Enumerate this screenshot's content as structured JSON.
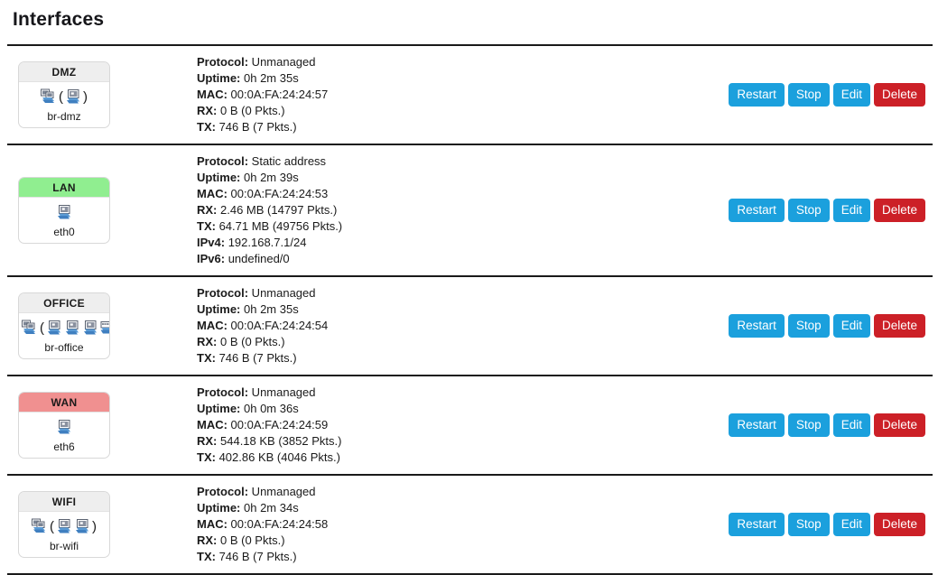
{
  "page": {
    "title": "Interfaces"
  },
  "actions": {
    "restart_label": "Restart",
    "stop_label": "Stop",
    "edit_label": "Edit",
    "delete_label": "Delete",
    "blue_color": "#1ba0dd",
    "red_color": "#cc2027"
  },
  "labels": {
    "protocol": "Protocol:",
    "uptime": "Uptime:",
    "mac": "MAC:",
    "rx": "RX:",
    "tx": "TX:",
    "ipv4": "IPv4:",
    "ipv6": "IPv6:"
  },
  "interfaces": [
    {
      "zone": "DMZ",
      "zone_color": "#eeeeee",
      "device": "br-dmz",
      "icons": [
        "bridge-icon",
        "paren-open",
        "ethernet-icon",
        "paren-close"
      ],
      "protocol": "Unmanaged",
      "uptime": "0h 2m 35s",
      "mac": "00:0A:FA:24:24:57",
      "rx": "0 B (0 Pkts.)",
      "tx": "746 B (7 Pkts.)",
      "ipv4": null,
      "ipv6": null
    },
    {
      "zone": "LAN",
      "zone_color": "#90ee90",
      "device": "eth0",
      "icons": [
        "ethernet-icon"
      ],
      "protocol": "Static address",
      "uptime": "0h 2m 39s",
      "mac": "00:0A:FA:24:24:53",
      "rx": "2.46 MB (14797 Pkts.)",
      "tx": "64.71 MB (49756 Pkts.)",
      "ipv4": "192.168.7.1/24",
      "ipv6": "undefined/0"
    },
    {
      "zone": "OFFICE",
      "zone_color": "#eeeeee",
      "device": "br-office",
      "icons": [
        "bridge-icon",
        "paren-open",
        "ethernet-icon",
        "ethernet-icon",
        "ethernet-icon",
        "switch-icon",
        "switch-icon",
        "paren-close"
      ],
      "protocol": "Unmanaged",
      "uptime": "0h 2m 35s",
      "mac": "00:0A:FA:24:24:54",
      "rx": "0 B (0 Pkts.)",
      "tx": "746 B (7 Pkts.)",
      "ipv4": null,
      "ipv6": null
    },
    {
      "zone": "WAN",
      "zone_color": "#f09090",
      "device": "eth6",
      "icons": [
        "ethernet-icon"
      ],
      "protocol": "Unmanaged",
      "uptime": "0h 0m 36s",
      "mac": "00:0A:FA:24:24:59",
      "rx": "544.18 KB (3852 Pkts.)",
      "tx": "402.86 KB (4046 Pkts.)",
      "ipv4": null,
      "ipv6": null
    },
    {
      "zone": "WIFI",
      "zone_color": "#eeeeee",
      "device": "br-wifi",
      "icons": [
        "bridge-icon",
        "paren-open",
        "ethernet-icon",
        "ethernet-icon",
        "paren-close"
      ],
      "protocol": "Unmanaged",
      "uptime": "0h 2m 34s",
      "mac": "00:0A:FA:24:24:58",
      "rx": "0 B (0 Pkts.)",
      "tx": "746 B (7 Pkts.)",
      "ipv4": null,
      "ipv6": null
    }
  ]
}
